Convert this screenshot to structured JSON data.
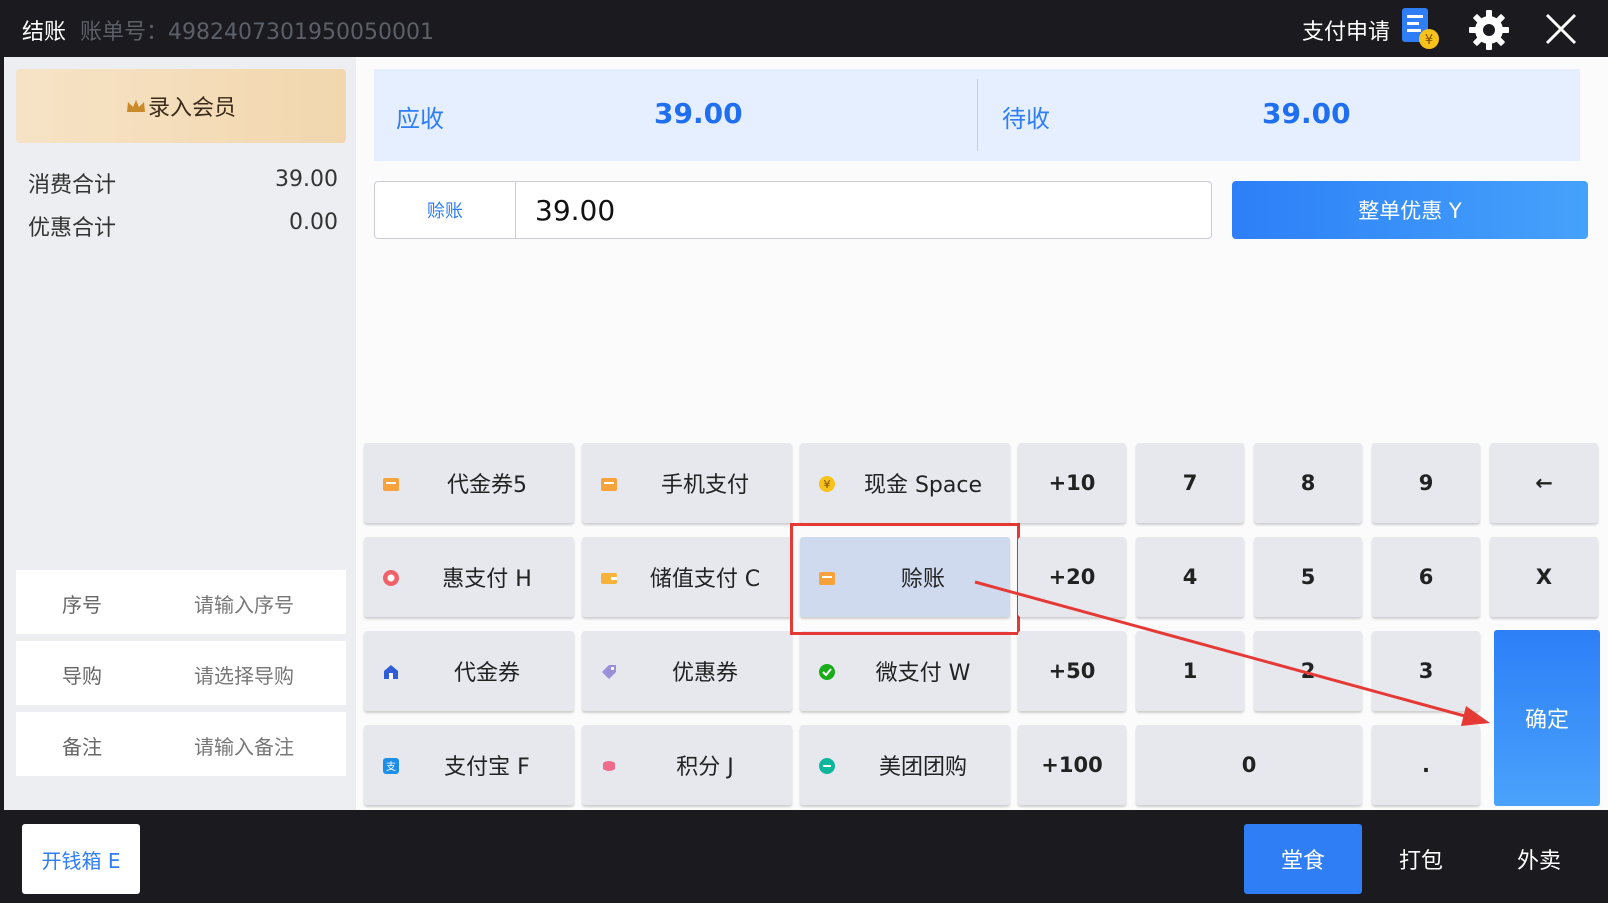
{
  "header": {
    "title": "结账",
    "bill_number": "账单号：4982407301950050001",
    "payment_request": "支付申请"
  },
  "left_panel": {
    "member_button": "录入会员",
    "summary": [
      {
        "label": "消费合计",
        "value": "39.00"
      },
      {
        "label": "优惠合计",
        "value": "0.00"
      }
    ],
    "fields": [
      {
        "label": "序号",
        "placeholder": "请输入序号"
      },
      {
        "label": "导购",
        "placeholder": "请选择导购"
      },
      {
        "label": "备注",
        "placeholder": "请输入备注"
      }
    ]
  },
  "summary": {
    "receivable_label": "应收",
    "receivable_value": "39.00",
    "pending_label": "待收",
    "pending_value": "39.00"
  },
  "input": {
    "method_tag": "赊账",
    "amount": "39.00"
  },
  "discount_button": "整单优惠 Y",
  "payment_methods": [
    "代金券5",
    "手机支付",
    "现金 Space",
    "惠支付 H",
    "储值支付 C",
    "赊账",
    "代金券",
    "优惠券",
    "微支付 W",
    "支付宝 F",
    "积分 J",
    "美团团购"
  ],
  "quick_amounts": [
    "+10",
    "+20",
    "+50",
    "+100"
  ],
  "keypad": [
    "7",
    "8",
    "9",
    "←",
    "4",
    "5",
    "6",
    "X",
    "1",
    "2",
    "3",
    "0",
    "."
  ],
  "confirm_button": "确定",
  "footer": {
    "cash_drawer": "开钱箱 E",
    "modes": [
      "堂食",
      "打包",
      "外卖"
    ]
  },
  "colors": {
    "accent": "#2f7ef5",
    "highlight": "#e53935",
    "member_gold": "#f2d7ae"
  }
}
